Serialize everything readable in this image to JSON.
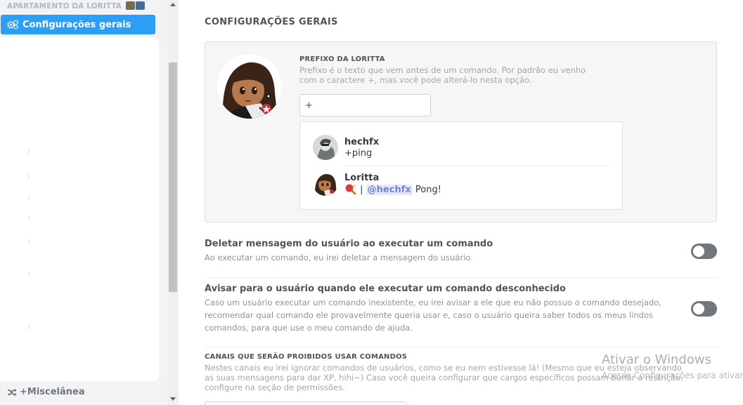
{
  "sidebar": {
    "server_name": "APARTAMENTO DA LORITTA",
    "active_item": {
      "label": "Configurações gerais",
      "icon": "gears-icon"
    },
    "bottom_item": {
      "label": "+Miscelânea",
      "icon": "shuffle-icon"
    }
  },
  "main": {
    "title": "CONFIGURAÇÕES GERAIS",
    "prefix": {
      "label": "PREFIXO DA LORITTA",
      "description": "Prefixo é o texto que vem antes de um comando. Por padrão eu venho com o caractere +, mas você pode alterá-lo nesta opção.",
      "value": "+"
    },
    "preview": {
      "user": {
        "name": "hechfx",
        "text": "+ping"
      },
      "bot": {
        "name": "Loritta",
        "separator": "|",
        "mention": "@hechfx",
        "reply": "Pong!"
      }
    },
    "options": [
      {
        "title": "Deletar mensagem do usuário ao executar um comando",
        "description": "Ao executar um comando, eu irei deletar a mensagem do usuário.",
        "enabled": false
      },
      {
        "title": "Avisar para o usuário quando ele executar um comando desconhecido",
        "description": "Caso um usuário executar um comando inexistente, eu irei avisar a ele que eu não possuo o comando desejado, recomendar qual comando ele provavelmente queria usar e, caso o usuário queira saber todos os meus lindos comandos, para que use o meu comando de ajuda.",
        "enabled": false
      }
    ],
    "blocked_channels": {
      "label": "CANAIS QUE SERÃO PROIBIDOS USAR COMANDOS",
      "description": "Nestes canais eu irei ignorar comandos de usuários, como se eu nem estivesse lá! (Mesmo que eu esteja observando as suas mensagens para dar XP, hihi~) Caso você queira configurar que cargos específicos possam burlar a restrição, configure na seção de permissões."
    }
  },
  "watermark": {
    "title": "Ativar o Windows",
    "subtitle": "Acesse Configurações para ativar o Windows."
  },
  "colors": {
    "accent": "#2c9ef5",
    "toggle_off": "#72767d",
    "mention_bg": "#e6e9fd",
    "mention_text": "#6f85d5"
  }
}
